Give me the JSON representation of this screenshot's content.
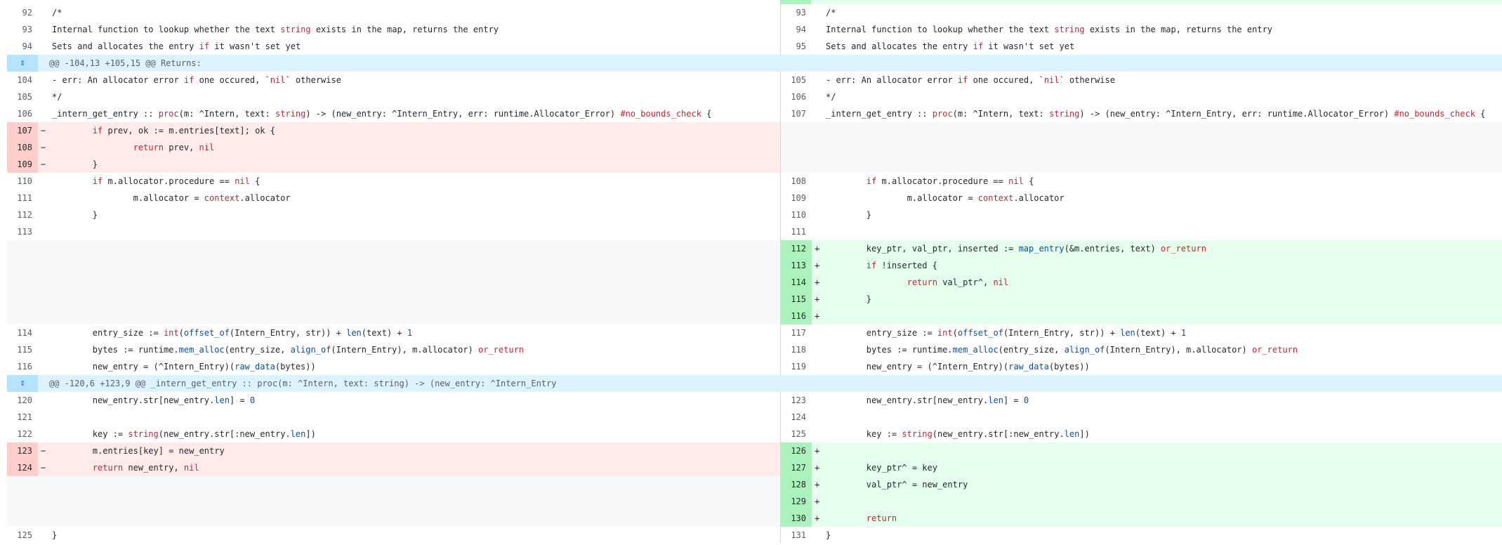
{
  "hunks": [
    {
      "text": "@@ -104,13 +105,15 @@ Returns:"
    },
    {
      "text": "@@ -120,6 +123,9 @@ _intern_get_entry :: proc(m: ^Intern, text: string) -> (new_entry: ^Intern_Entry"
    }
  ],
  "lines": [
    {
      "type": "ctx",
      "l": "92",
      "r": "93",
      "code": "/*"
    },
    {
      "type": "ctx",
      "l": "93",
      "r": "94",
      "code": "Internal function to lookup whether the text string exists in the map, returns the entry"
    },
    {
      "type": "ctx",
      "l": "94",
      "r": "95",
      "code": "Sets and allocates the entry if it wasn't set yet"
    },
    {
      "type": "hunk",
      "hunk": 0
    },
    {
      "type": "ctx",
      "l": "104",
      "r": "105",
      "code": "- err: An allocator error if one occured, `nil` otherwise"
    },
    {
      "type": "ctx",
      "l": "105",
      "r": "106",
      "code": "*/"
    },
    {
      "type": "ctx",
      "l": "106",
      "r": "107",
      "code": "_intern_get_entry :: proc(m: ^Intern, text: string) -> (new_entry: ^Intern_Entry, err: runtime.Allocator_Error) #no_bounds_check {"
    },
    {
      "type": "del",
      "l": "107",
      "code": "        if prev, ok := m.entries[text]; ok {"
    },
    {
      "type": "del",
      "l": "108",
      "code": "                return prev, nil"
    },
    {
      "type": "del",
      "l": "109",
      "code": "        }"
    },
    {
      "type": "ctx",
      "l": "110",
      "r": "108",
      "code": "        if m.allocator.procedure == nil {"
    },
    {
      "type": "ctx",
      "l": "111",
      "r": "109",
      "code": "                m.allocator = context.allocator"
    },
    {
      "type": "ctx",
      "l": "112",
      "r": "110",
      "code": "        }"
    },
    {
      "type": "ctx",
      "l": "113",
      "r": "111",
      "code": ""
    },
    {
      "type": "add",
      "r": "112",
      "code": "        key_ptr, val_ptr, inserted := map_entry(&m.entries, text) or_return"
    },
    {
      "type": "add",
      "r": "113",
      "code": "        if !inserted {"
    },
    {
      "type": "add",
      "r": "114",
      "code": "                return val_ptr^, nil"
    },
    {
      "type": "add",
      "r": "115",
      "code": "        }"
    },
    {
      "type": "add",
      "r": "116",
      "code": ""
    },
    {
      "type": "ctx",
      "l": "114",
      "r": "117",
      "code": "        entry_size := int(offset_of(Intern_Entry, str)) + len(text) + 1"
    },
    {
      "type": "ctx",
      "l": "115",
      "r": "118",
      "code": "        bytes := runtime.mem_alloc(entry_size, align_of(Intern_Entry), m.allocator) or_return"
    },
    {
      "type": "ctx",
      "l": "116",
      "r": "119",
      "code": "        new_entry = (^Intern_Entry)(raw_data(bytes))"
    },
    {
      "type": "hunk",
      "hunk": 1
    },
    {
      "type": "ctx",
      "l": "120",
      "r": "123",
      "code": "        new_entry.str[new_entry.len] = 0"
    },
    {
      "type": "ctx",
      "l": "121",
      "r": "124",
      "code": ""
    },
    {
      "type": "ctx",
      "l": "122",
      "r": "125",
      "code": "        key := string(new_entry.str[:new_entry.len])"
    },
    {
      "type": "pair",
      "l": "123",
      "lcode": "        m.entries[key] = new_entry",
      "r": "126",
      "rcode": ""
    },
    {
      "type": "pair",
      "l": "124",
      "lcode": "        return new_entry, nil",
      "r": "127",
      "rcode": "        key_ptr^ = key"
    },
    {
      "type": "add",
      "r": "128",
      "code": "        val_ptr^ = new_entry"
    },
    {
      "type": "add",
      "r": "129",
      "code": ""
    },
    {
      "type": "add",
      "r": "130",
      "code": "        return"
    },
    {
      "type": "ctx",
      "l": "125",
      "r": "131",
      "code": "}"
    }
  ],
  "markers": {
    "del": "−",
    "add": "+"
  },
  "keywords": [
    "proc",
    "string",
    "return",
    "if",
    "or_return",
    "int",
    "nil",
    "context"
  ],
  "functions": [
    "offset_of",
    "len",
    "mem_alloc",
    "align_of",
    "raw_data",
    "map_entry"
  ]
}
